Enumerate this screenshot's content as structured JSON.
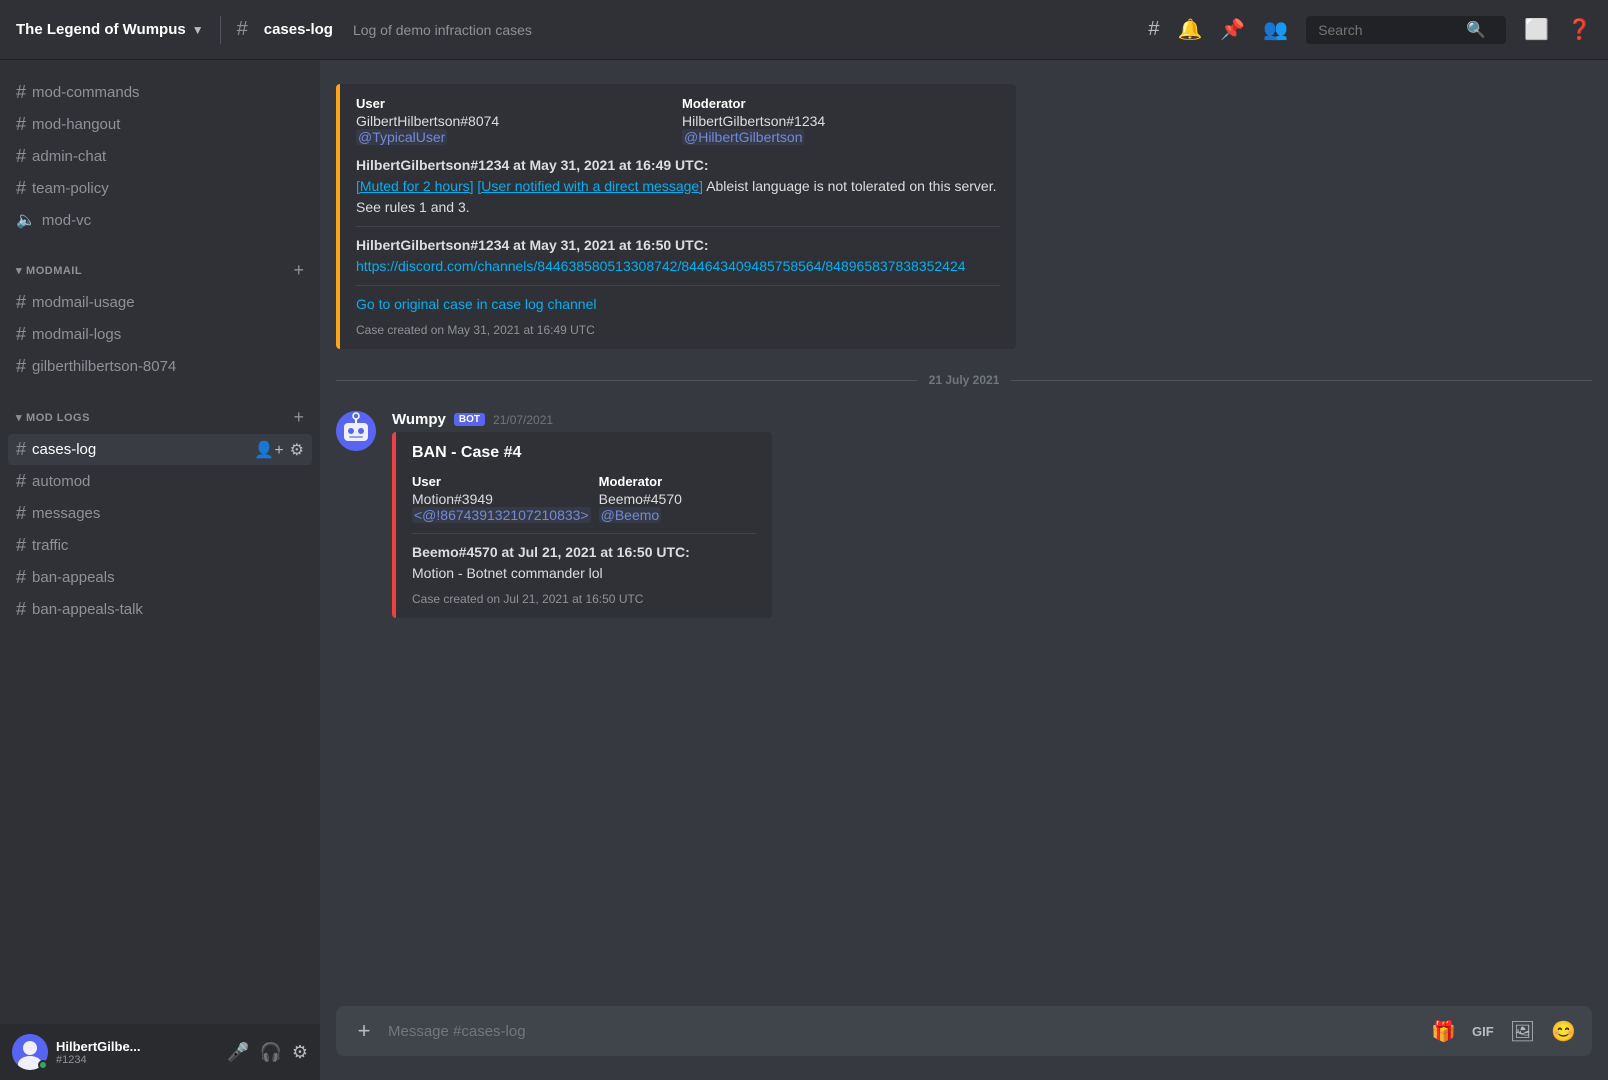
{
  "app": {
    "server_name": "The Legend of Wumpus",
    "channel_name": "cases-log",
    "channel_description": "Log of demo infraction cases"
  },
  "header": {
    "icons": {
      "hash": "#",
      "bell": "🔔",
      "pin": "📌",
      "members": "👥",
      "search_placeholder": "Search",
      "inbox": "📥",
      "help": "?"
    }
  },
  "sidebar": {
    "sections": [
      {
        "channels": [
          {
            "id": "mod-commands",
            "name": "mod-commands",
            "type": "text"
          },
          {
            "id": "mod-hangout",
            "name": "mod-hangout",
            "type": "text"
          },
          {
            "id": "admin-chat",
            "name": "admin-chat",
            "type": "text"
          },
          {
            "id": "team-policy",
            "name": "team-policy",
            "type": "text"
          },
          {
            "id": "mod-vc",
            "name": "mod-vc",
            "type": "voice"
          }
        ]
      },
      {
        "label": "MODMAIL",
        "channels": [
          {
            "id": "modmail-usage",
            "name": "modmail-usage",
            "type": "text"
          },
          {
            "id": "modmail-logs",
            "name": "modmail-logs",
            "type": "text"
          },
          {
            "id": "gilberthilbertson-8074",
            "name": "gilberthilbertson-8074",
            "type": "text"
          }
        ]
      },
      {
        "label": "MOD LOGS",
        "channels": [
          {
            "id": "cases-log",
            "name": "cases-log",
            "type": "text",
            "active": true
          },
          {
            "id": "automod",
            "name": "automod",
            "type": "text"
          },
          {
            "id": "messages",
            "name": "messages",
            "type": "text"
          },
          {
            "id": "traffic",
            "name": "traffic",
            "type": "text"
          },
          {
            "id": "ban-appeals",
            "name": "ban-appeals",
            "type": "text"
          },
          {
            "id": "ban-appeals-talk",
            "name": "ban-appeals-talk",
            "type": "text"
          }
        ]
      }
    ]
  },
  "messages": {
    "top_embed": {
      "border_color": "#faa61a",
      "user_label": "User",
      "user_value": "GilbertHilbertson#8074",
      "user_mention": "@TypicalUser",
      "moderator_label": "Moderator",
      "moderator_value": "HilbertGilbertson#1234",
      "moderator_mention": "@HilbertGilbertson",
      "action1_author": "HilbertGilbertson#1234 at May 31, 2021 at 16:49 UTC:",
      "muted_tag": "[Muted for 2 hours]",
      "notified_tag": "[User notified with a direct message]",
      "action1_text": " Ableist language is not tolerated on this server. See rules 1 and 3.",
      "action2_author": "HilbertGilbertson#1234 at May 31, 2021 at 16:50 UTC:",
      "discord_link": "https://discord.com/channels/844638580513308742/844643409485758564/848965837838352424",
      "go_to_case_link": "Go to original case in case log channel",
      "case_created": "Case created on May 31, 2021 at 16:49 UTC"
    },
    "date_divider": "21 July 2021",
    "bot_message": {
      "author": "Wumpy",
      "bot_badge": "BOT",
      "timestamp": "21/07/2021",
      "embed": {
        "border_color": "#ed4245",
        "title": "BAN - Case #4",
        "user_label": "User",
        "user_value": "Motion#3949",
        "user_mention": "<@!867439132107210833>",
        "moderator_label": "Moderator",
        "moderator_value": "Beemo#4570",
        "moderator_mention": "@Beemo",
        "action_author": "Beemo#4570 at Jul 21, 2021 at 16:50 UTC:",
        "action_text": "Motion - Botnet commander lol",
        "case_created": "Case created on Jul 21, 2021 at 16:50 UTC"
      }
    }
  },
  "message_input": {
    "placeholder": "Message #cases-log"
  },
  "user": {
    "name": "HilbertGilbe...",
    "tag": "#1234"
  }
}
